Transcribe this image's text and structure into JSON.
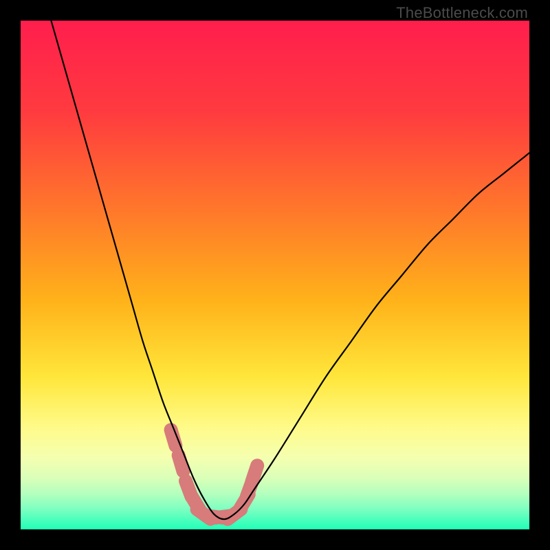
{
  "watermark": "TheBottleneck.com",
  "colors": {
    "frame": "#000000",
    "watermark": "#4b4b4b",
    "curve_stroke": "#000000",
    "marker_fill": "#d77b7b",
    "gradient_stops": [
      {
        "offset": "0%",
        "color": "#ff1e4d"
      },
      {
        "offset": "18%",
        "color": "#ff3b3f"
      },
      {
        "offset": "38%",
        "color": "#ff7a2a"
      },
      {
        "offset": "55%",
        "color": "#ffb21a"
      },
      {
        "offset": "70%",
        "color": "#ffe63a"
      },
      {
        "offset": "80%",
        "color": "#fffb8a"
      },
      {
        "offset": "86%",
        "color": "#f4ffb0"
      },
      {
        "offset": "90%",
        "color": "#d9ffb8"
      },
      {
        "offset": "93%",
        "color": "#b4ffbe"
      },
      {
        "offset": "96%",
        "color": "#7dffc0"
      },
      {
        "offset": "98%",
        "color": "#4effbd"
      },
      {
        "offset": "100%",
        "color": "#21ffb7"
      }
    ]
  },
  "chart_data": {
    "type": "line",
    "title": "",
    "xlabel": "",
    "ylabel": "",
    "xlim": [
      0,
      100
    ],
    "ylim": [
      0,
      100
    ],
    "note": "V-shaped bottleneck curve; y-axis inverted visually so low values sit at the bottom (green zone). Minimum of the curve lies around x≈34–40 at y≈2–4. Thick pink markers cluster near the trough.",
    "series": [
      {
        "name": "bottleneck-curve",
        "description": "Continuous black curve descending steeply from upper-left, bottoming out near x≈37, then rising toward upper-right with a gentler slope.",
        "x": [
          6,
          8,
          10,
          12,
          14,
          16,
          18,
          20,
          22,
          24,
          26,
          28,
          30,
          32,
          34,
          36,
          38,
          40,
          42,
          44,
          46,
          50,
          55,
          60,
          65,
          70,
          75,
          80,
          85,
          90,
          95,
          100
        ],
        "y": [
          100,
          93,
          86,
          79,
          72,
          65,
          58,
          51,
          44,
          37,
          31,
          25,
          20,
          15,
          10,
          6,
          3,
          2,
          3,
          5,
          8,
          14,
          22,
          30,
          37,
          44,
          50,
          56,
          61,
          66,
          70,
          74
        ]
      }
    ],
    "markers": {
      "name": "trough-markers",
      "description": "Thick rounded pink segments / dots clustered at and around the curve minimum.",
      "points": [
        {
          "x": 30,
          "y": 18
        },
        {
          "x": 31.5,
          "y": 13
        },
        {
          "x": 33,
          "y": 8
        },
        {
          "x": 34.5,
          "y": 5
        },
        {
          "x": 36,
          "y": 3
        },
        {
          "x": 38,
          "y": 2.5
        },
        {
          "x": 40,
          "y": 2.5
        },
        {
          "x": 42,
          "y": 3
        },
        {
          "x": 44,
          "y": 5.5
        },
        {
          "x": 45,
          "y": 8
        },
        {
          "x": 46,
          "y": 11
        }
      ]
    }
  }
}
